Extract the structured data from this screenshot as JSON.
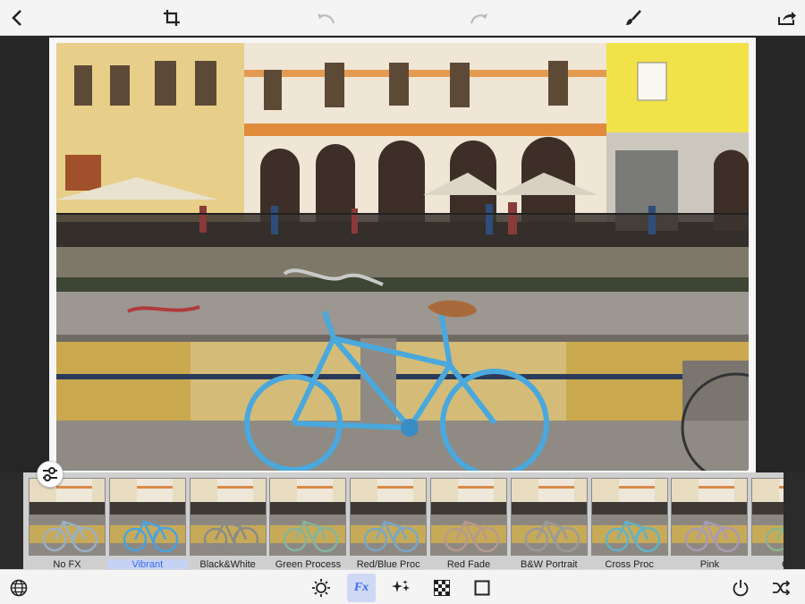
{
  "toolbar": {
    "back": "back-icon",
    "crop": "crop-icon",
    "undo": "undo-icon",
    "redo": "redo-icon",
    "brush": "brush-icon",
    "share": "share-icon"
  },
  "filters": [
    {
      "label": "No FX",
      "selected": false,
      "tint": "#9ab0c6"
    },
    {
      "label": "Vibrant",
      "selected": true,
      "tint": "#4aa2e0"
    },
    {
      "label": "Black&White",
      "selected": false,
      "tint": "#8a8a8a"
    },
    {
      "label": "Green Process",
      "selected": false,
      "tint": "#86b49a"
    },
    {
      "label": "Red/Blue Proc",
      "selected": false,
      "tint": "#7aa6c4"
    },
    {
      "label": "Red Fade",
      "selected": false,
      "tint": "#b49a8c"
    },
    {
      "label": "B&W Portrait",
      "selected": false,
      "tint": "#9a9a9a"
    },
    {
      "label": "Cross Proc",
      "selected": false,
      "tint": "#62b2c6"
    },
    {
      "label": "Pink",
      "selected": false,
      "tint": "#a89ab4"
    },
    {
      "label": "Gre",
      "selected": false,
      "tint": "#8ab48c"
    }
  ],
  "bottombar": {
    "globe": "globe-icon",
    "adjust": "brightness-icon",
    "fx_label": "Fx",
    "stars": "sparkle-icon",
    "checker": "checker-icon",
    "frame": "frame-icon",
    "power": "power-icon",
    "shuffle": "shuffle-icon"
  },
  "colors": {
    "accent": "#3a6cf0",
    "selected_bg": "#c6d2f4",
    "bike": "#4aa8dc"
  }
}
